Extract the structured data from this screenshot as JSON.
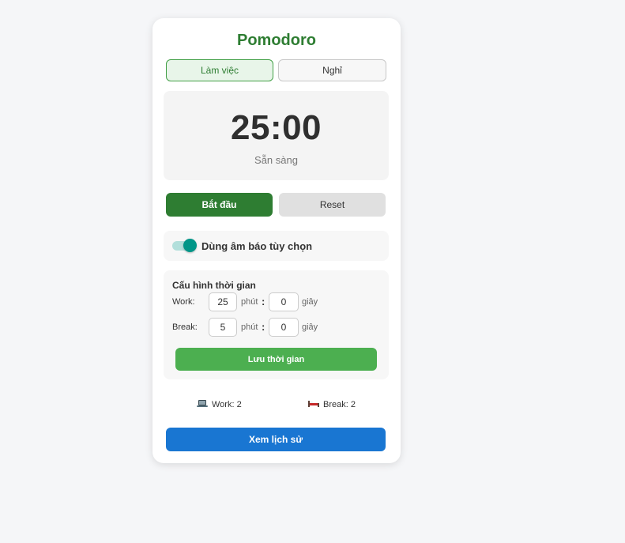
{
  "app": {
    "title": "Pomodoro"
  },
  "modes": {
    "work_label": "Làm việc",
    "break_label": "Nghỉ",
    "active": "work"
  },
  "timer": {
    "display": "25:00",
    "status": "Sẵn sàng"
  },
  "controls": {
    "start_label": "Bắt đầu",
    "reset_label": "Reset"
  },
  "sound": {
    "label": "Dùng âm báo tùy chọn",
    "enabled": true
  },
  "config": {
    "title": "Cấu hình thời gian",
    "work": {
      "label": "Work:",
      "minutes": "25",
      "seconds": "0"
    },
    "break": {
      "label": "Break:",
      "minutes": "5",
      "seconds": "0"
    },
    "minutes_unit": "phút",
    "seconds_unit": "giây",
    "separator": ":",
    "save_label": "Lưu thời gian"
  },
  "stats": {
    "work_icon": "laptop-icon",
    "work_text": "Work: 2",
    "break_icon": "bed-icon",
    "break_text": "Break: 2"
  },
  "history": {
    "button_label": "Xem lịch sử"
  },
  "colors": {
    "title_green": "#2e7d32",
    "start_green": "#2e7d32",
    "save_green": "#4caf50",
    "history_blue": "#1976d2",
    "toggle_teal": "#009688"
  }
}
